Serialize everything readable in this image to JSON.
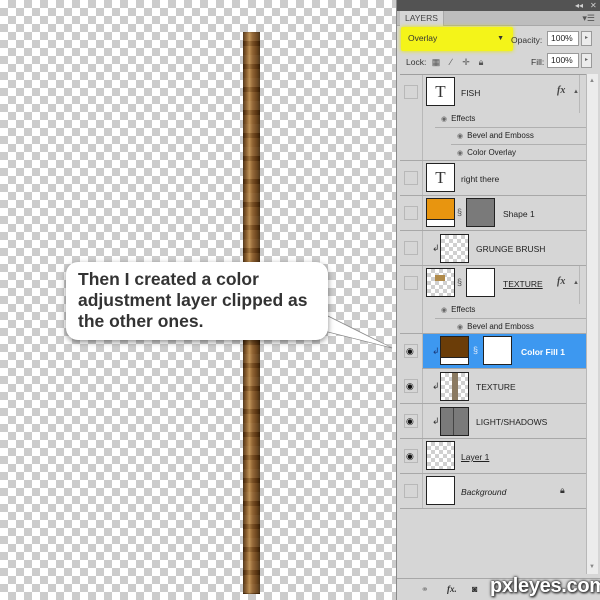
{
  "canvas": {
    "callout_text": "Then I created a color adjustment layer clipped as the other ones."
  },
  "panel": {
    "tab_label": "LAYERS",
    "blend_mode": "Overlay",
    "opacity_label": "Opacity:",
    "opacity_value": "100%",
    "lock_label": "Lock:",
    "fill_label": "Fill:",
    "fill_value": "100%",
    "highlight_color": "#f4f419",
    "selected_color": "#3d98f0"
  },
  "layers": [
    {
      "name": "FISH",
      "type": "text",
      "visible": false,
      "fx": true,
      "effects_label": "Effects",
      "effects": [
        "Bevel and Emboss",
        "Color Overlay"
      ]
    },
    {
      "name": "right there",
      "type": "text",
      "visible": false
    },
    {
      "name": "Shape 1",
      "type": "shape",
      "visible": false,
      "fill_color": "#e8950f"
    },
    {
      "name": "GRUNGE BRUSH",
      "type": "raster",
      "visible": false,
      "clipped": true
    },
    {
      "name": "TEXTURE",
      "type": "raster-masked",
      "visible": false,
      "fx": true,
      "effects_label": "Effects",
      "effects": [
        "Bevel and Emboss"
      ]
    },
    {
      "name": "Color Fill 1",
      "type": "fill",
      "visible": true,
      "clipped": true,
      "selected": true,
      "fill_color": "#6b3d08"
    },
    {
      "name": "TEXTURE",
      "type": "raster",
      "visible": true,
      "clipped": true
    },
    {
      "name": "LIGHT/SHADOWS",
      "type": "raster",
      "visible": true,
      "clipped": true
    },
    {
      "name": "Layer 1",
      "type": "raster",
      "visible": true
    },
    {
      "name": "Background",
      "type": "background",
      "visible": false,
      "locked": true
    }
  ],
  "bottom_bar": {
    "icons": [
      "link-icon",
      "fx-icon",
      "mask-icon"
    ]
  },
  "watermark": "pxleyes.com"
}
